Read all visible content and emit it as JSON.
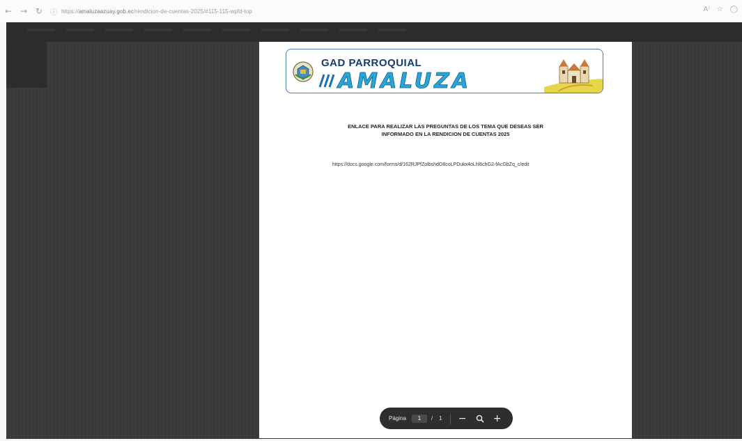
{
  "browser": {
    "url_prefix": "https://",
    "url_domain": "amaluzaazuay.gob.ec",
    "url_path": "/rendicion-de-cuentas-2025/#115-115-wpfd-top",
    "icons": {
      "back": "arrow-left-icon",
      "forward": "arrow-right-icon",
      "reload": "reload-icon",
      "lock": "info-icon",
      "read_aloud": "read-aloud-icon",
      "favorite": "star-icon",
      "profile": "circle-icon"
    }
  },
  "pdf": {
    "banner": {
      "line1": "GAD PARROQUIAL",
      "line2": "AMALUZA"
    },
    "heading_line1": "ENLACE PARA REALIZAR LAS PREGUNTAS DE LOS TEMA QUE DESEAS SER",
    "heading_line2": "INFORMADO EN LA RENDICION DE CUENTAS 2025",
    "link_text": "https://docs.google.com/forms/d/162RJPfZolbshdO8coLPDukx4oLhl6chG2-fAcGbZq_c/edit"
  },
  "page_controls": {
    "label": "Página",
    "current_page": "1",
    "separator": "/",
    "total_pages": "1",
    "zoom_out": "−",
    "zoom_icon": "magnifier-icon",
    "zoom_in": "+"
  },
  "colors": {
    "viewer_bg": "#3b3a3b",
    "banner_border": "#4a79b8",
    "banner_title": "#2aa5d8",
    "banner_text": "#163b70"
  }
}
